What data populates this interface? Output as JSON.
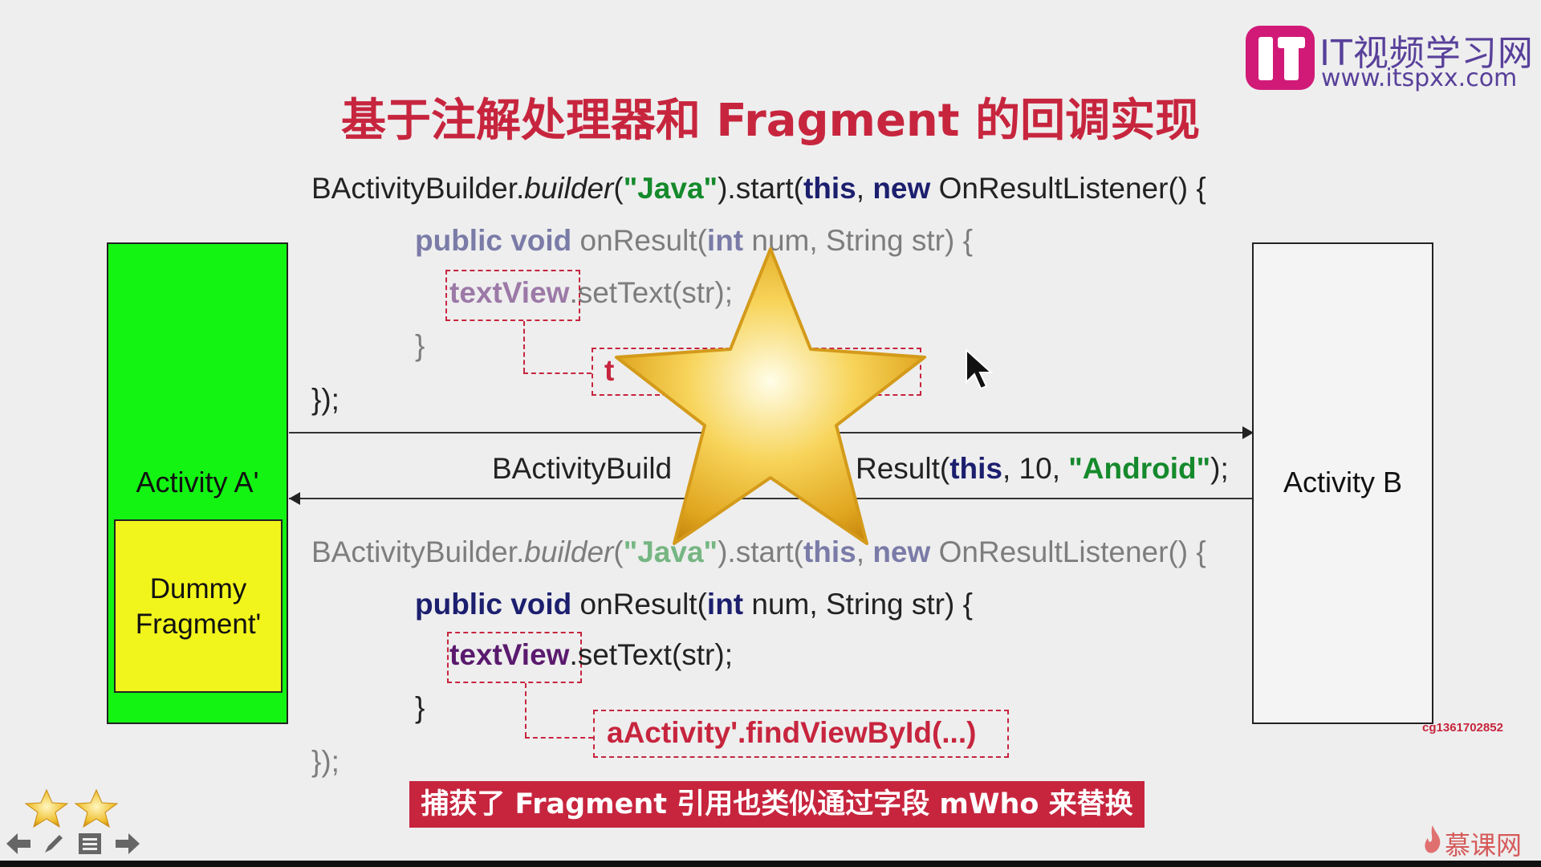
{
  "header": {
    "logo_title": "IT视频学习网",
    "logo_url": "www.itspxx.com",
    "title": "基于注解处理器和 Fragment 的回调实现"
  },
  "code_top": {
    "l1_a": "BActivityBuilder.",
    "l1_b": "builder",
    "l1_c": "(",
    "l1_d": "\"Java\"",
    "l1_e": ").start(",
    "l1_f": "this",
    "l1_g": ", ",
    "l1_h": "new",
    "l1_i": " OnResultListener() {",
    "l2_a": "public void",
    "l2_b": " onResult(",
    "l2_c": "int",
    "l2_d": " num, String str) {",
    "l3_a": "textView",
    "l3_b": ".setText(str);",
    "l4": "}",
    "l5": "});",
    "find_partial": "t"
  },
  "middle": {
    "l_a": "BActivityBuild",
    "l_b": "Result(",
    "l_c": "this",
    "l_d": ", 10, ",
    "l_e": "\"Android\"",
    "l_f": ");"
  },
  "code_bottom": {
    "l1_a": "BActivityBuilder.",
    "l1_b": "builder",
    "l1_c": "(",
    "l1_d": "\"Java\"",
    "l1_e": ").start(",
    "l1_f": "this",
    "l1_g": ", ",
    "l1_h": "new",
    "l1_i": " OnResultListener() {",
    "l2_a": "public void",
    "l2_b": " onResult(",
    "l2_c": "int",
    "l2_d": " num, String str) {",
    "l3_a": "textView",
    "l3_b": ".setText(str);",
    "l4": "}",
    "l5": "});",
    "find": "aActivity'.findViewById(...)"
  },
  "diagram": {
    "activity_a": "Activity A'",
    "dummy_line1": "Dummy",
    "dummy_line2": "Fragment'",
    "activity_b": "Activity B"
  },
  "watermark_id": "cg1361702852",
  "caption": "捕获了 Fragment 引用也类似通过字段 mWho 来替换",
  "brand_bottom": "慕课网",
  "colors": {
    "title_red": "#c7253e",
    "activity_a_green": "#13f413",
    "dummy_yellow": "#f2f51c",
    "keyword_navy": "#1c1f6e",
    "string_green": "#158a2c",
    "logo_purple": "#58409a",
    "logo_magenta": "#d11a78"
  },
  "icons": [
    "star-overlay-icon",
    "mouse-cursor-icon",
    "rating-star-icon",
    "prev-arrow-icon",
    "pen-icon",
    "menu-icon",
    "next-arrow-icon",
    "flame-icon"
  ]
}
